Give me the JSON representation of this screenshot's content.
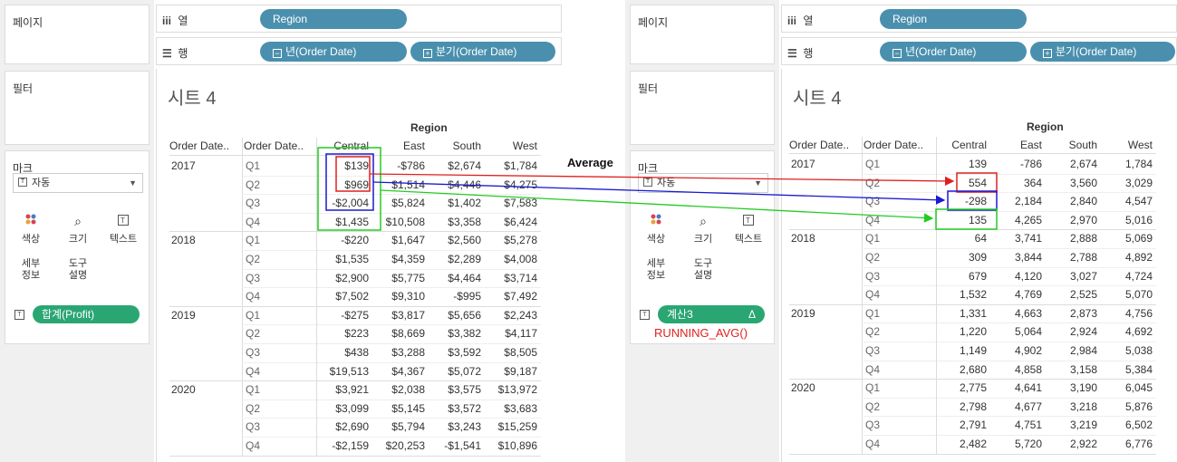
{
  "labels": {
    "pages": "페이지",
    "filters": "필터",
    "marks": "마크",
    "columns": "열",
    "rows": "행",
    "region_pill": "Region",
    "year_pill": "년(Order Date)",
    "quarter_pill": "분기(Order Date)",
    "sheet_title": "시트 4",
    "region_header": "Region",
    "order_date_hdr": "Order Date..",
    "auto": "자동",
    "color": "색상",
    "size": "크기",
    "text": "텍스트",
    "detail": "세부\n정보",
    "tooltip": "도구\n설명"
  },
  "left": {
    "measure_pill": "합계(Profit)",
    "columns": [
      "Central",
      "East",
      "South",
      "West"
    ],
    "rows": [
      {
        "year": "2017",
        "quarter": "Q1",
        "values": [
          "$139",
          "-$786",
          "$2,674",
          "$1,784"
        ]
      },
      {
        "year": "",
        "quarter": "Q2",
        "values": [
          "$969",
          "$1,514",
          "$4,446",
          "$4,275"
        ]
      },
      {
        "year": "",
        "quarter": "Q3",
        "values": [
          "-$2,004",
          "$5,824",
          "$1,402",
          "$7,583"
        ]
      },
      {
        "year": "",
        "quarter": "Q4",
        "values": [
          "$1,435",
          "$10,508",
          "$3,358",
          "$6,424"
        ]
      },
      {
        "year": "2018",
        "quarter": "Q1",
        "values": [
          "-$220",
          "$1,647",
          "$2,560",
          "$5,278"
        ]
      },
      {
        "year": "",
        "quarter": "Q2",
        "values": [
          "$1,535",
          "$4,359",
          "$2,289",
          "$4,008"
        ]
      },
      {
        "year": "",
        "quarter": "Q3",
        "values": [
          "$2,900",
          "$5,775",
          "$4,464",
          "$3,714"
        ]
      },
      {
        "year": "",
        "quarter": "Q4",
        "values": [
          "$7,502",
          "$9,310",
          "-$995",
          "$7,492"
        ]
      },
      {
        "year": "2019",
        "quarter": "Q1",
        "values": [
          "-$275",
          "$3,817",
          "$5,656",
          "$2,243"
        ]
      },
      {
        "year": "",
        "quarter": "Q2",
        "values": [
          "$223",
          "$8,669",
          "$3,382",
          "$4,117"
        ]
      },
      {
        "year": "",
        "quarter": "Q3",
        "values": [
          "$438",
          "$3,288",
          "$3,592",
          "$8,505"
        ]
      },
      {
        "year": "",
        "quarter": "Q4",
        "values": [
          "$19,513",
          "$4,367",
          "$5,072",
          "$9,187"
        ]
      },
      {
        "year": "2020",
        "quarter": "Q1",
        "values": [
          "$3,921",
          "$2,038",
          "$3,575",
          "$13,972"
        ]
      },
      {
        "year": "",
        "quarter": "Q2",
        "values": [
          "$3,099",
          "$5,145",
          "$3,572",
          "$3,683"
        ]
      },
      {
        "year": "",
        "quarter": "Q3",
        "values": [
          "$2,690",
          "$5,794",
          "$3,243",
          "$15,259"
        ]
      },
      {
        "year": "",
        "quarter": "Q4",
        "values": [
          "-$2,159",
          "$20,253",
          "-$1,541",
          "$10,896"
        ]
      }
    ]
  },
  "right": {
    "measure_pill": "계산3",
    "delta_symbol": "Δ",
    "columns": [
      "Central",
      "East",
      "South",
      "West"
    ],
    "rows": [
      {
        "year": "2017",
        "quarter": "Q1",
        "values": [
          "139",
          "-786",
          "2,674",
          "1,784"
        ]
      },
      {
        "year": "",
        "quarter": "Q2",
        "values": [
          "554",
          "364",
          "3,560",
          "3,029"
        ]
      },
      {
        "year": "",
        "quarter": "Q3",
        "values": [
          "-298",
          "2,184",
          "2,840",
          "4,547"
        ]
      },
      {
        "year": "",
        "quarter": "Q4",
        "values": [
          "135",
          "4,265",
          "2,970",
          "5,016"
        ]
      },
      {
        "year": "2018",
        "quarter": "Q1",
        "values": [
          "64",
          "3,741",
          "2,888",
          "5,069"
        ]
      },
      {
        "year": "",
        "quarter": "Q2",
        "values": [
          "309",
          "3,844",
          "2,788",
          "4,892"
        ]
      },
      {
        "year": "",
        "quarter": "Q3",
        "values": [
          "679",
          "4,120",
          "3,027",
          "4,724"
        ]
      },
      {
        "year": "",
        "quarter": "Q4",
        "values": [
          "1,532",
          "4,769",
          "2,525",
          "5,070"
        ]
      },
      {
        "year": "2019",
        "quarter": "Q1",
        "values": [
          "1,331",
          "4,663",
          "2,873",
          "4,756"
        ]
      },
      {
        "year": "",
        "quarter": "Q2",
        "values": [
          "1,220",
          "5,064",
          "2,924",
          "4,692"
        ]
      },
      {
        "year": "",
        "quarter": "Q3",
        "values": [
          "1,149",
          "4,902",
          "2,984",
          "5,038"
        ]
      },
      {
        "year": "",
        "quarter": "Q4",
        "values": [
          "2,680",
          "4,858",
          "3,158",
          "5,384"
        ]
      },
      {
        "year": "2020",
        "quarter": "Q1",
        "values": [
          "2,775",
          "4,641",
          "3,190",
          "6,045"
        ]
      },
      {
        "year": "",
        "quarter": "Q2",
        "values": [
          "2,798",
          "4,677",
          "3,218",
          "5,876"
        ]
      },
      {
        "year": "",
        "quarter": "Q3",
        "values": [
          "2,791",
          "4,751",
          "3,219",
          "6,502"
        ]
      },
      {
        "year": "",
        "quarter": "Q4",
        "values": [
          "2,482",
          "5,720",
          "2,922",
          "6,776"
        ]
      }
    ]
  },
  "annotations": {
    "average": "Average",
    "function": "RUNNING_AVG()"
  },
  "colors": {
    "pill_blue": "#4a90ae",
    "pill_green": "#2aa672",
    "red": "#e02020",
    "blue": "#1a1ad0",
    "green": "#22cc22"
  }
}
